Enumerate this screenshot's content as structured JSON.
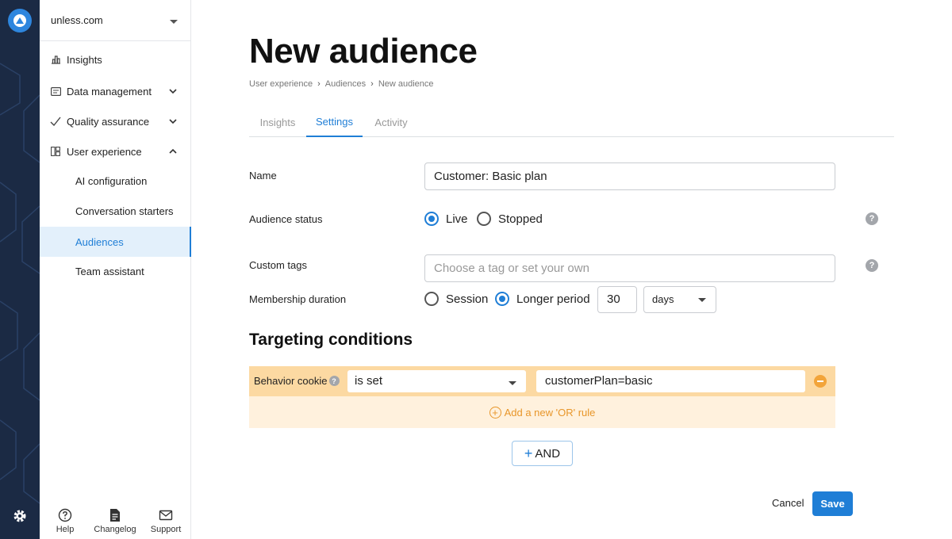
{
  "sidebar": {
    "site": "unless.com",
    "items": [
      {
        "label": "Insights"
      },
      {
        "label": "Data management"
      },
      {
        "label": "Quality assurance"
      },
      {
        "label": "User experience"
      }
    ],
    "sub_items": [
      {
        "label": "AI configuration"
      },
      {
        "label": "Conversation starters"
      },
      {
        "label": "Audiences"
      },
      {
        "label": "Team assistant"
      }
    ],
    "footer": {
      "help": "Help",
      "changelog": "Changelog",
      "support": "Support"
    }
  },
  "page": {
    "title": "New audience",
    "breadcrumb": [
      "User experience",
      "Audiences",
      "New audience"
    ],
    "tabs": [
      "Insights",
      "Settings",
      "Activity"
    ],
    "active_tab": "Settings"
  },
  "form": {
    "name_label": "Name",
    "name_value": "Customer: Basic plan",
    "status_label": "Audience status",
    "status_options": [
      "Live",
      "Stopped"
    ],
    "status_selected": "Live",
    "tags_label": "Custom tags",
    "tags_placeholder": "Choose a tag or set your own",
    "duration_label": "Membership duration",
    "duration_options": [
      "Session",
      "Longer period"
    ],
    "duration_selected": "Longer period",
    "duration_amount": "30",
    "duration_unit": "days"
  },
  "targeting": {
    "title": "Targeting conditions",
    "condition": {
      "type": "Behavior cookie",
      "operator": "is set",
      "value": "customerPlan=basic"
    },
    "add_or_label": "Add a new 'OR' rule",
    "and_label": "AND"
  },
  "actions": {
    "cancel": "Cancel",
    "save": "Save"
  },
  "colors": {
    "accent": "#1f7ed6",
    "rail": "#1b2a44",
    "condition_bg": "#fcd9a2",
    "or_row_bg": "#fff1dd",
    "or_text": "#e8962a"
  }
}
